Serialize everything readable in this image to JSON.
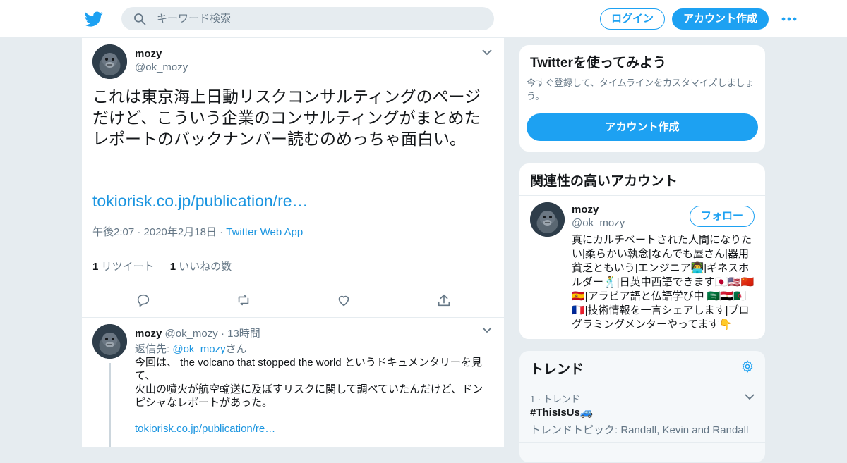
{
  "header": {
    "search_placeholder": "キーワード検索",
    "login_label": "ログイン",
    "signup_label": "アカウント作成"
  },
  "tweet": {
    "name": "mozy",
    "handle": "@ok_mozy",
    "text": "これは東京海上日動リスクコンサルティングのページだけど、こういう企業のコンサルティングがまとめたレポートのバックナンバー読むのめっちゃ面白い。",
    "link": "tokiorisk.co.jp/publication/re…",
    "timestamp": "午後2:07 · 2020年2月18日 ·",
    "via": "Twitter Web App",
    "retweet_count": "1",
    "retweet_label": "リツイート",
    "like_count": "1",
    "like_label": "いいねの数"
  },
  "reply": {
    "name": "mozy",
    "handle": "@ok_mozy",
    "time": "· 13時間",
    "reply_to_label": "返信先:",
    "reply_to_handle": "@ok_mozy",
    "reply_to_suffix": "さん",
    "text": "今回は、 the volcano that stopped the world というドキュメンタリーを見て、\n火山の噴火が航空輸送に及ぼすリスクに関して調べていたんだけど、ドンピシャなレポートがあった。",
    "link": "tokiorisk.co.jp/publication/re…"
  },
  "signup_card": {
    "title": "Twitterを使ってみよう",
    "desc": "今すぐ登録して、タイムラインをカスタマイズしましょう。",
    "button": "アカウント作成"
  },
  "related_card": {
    "title": "関連性の高いアカウント",
    "name": "mozy",
    "handle": "@ok_mozy",
    "follow_label": "フォロー",
    "bio": "真にカルチベートされた人間になりたい|柔らかい執念|なんでも屋さん|器用貧乏ともいう|エンジニア👨‍💻|ギネスホルダー🕺|日英中西語できます🇯🇵🇺🇸🇨🇳🇪🇸|アラビア語と仏語学び中 🇸🇦🇪🇬🇩🇿🇫🇷|技術情報を一言シェアします|プログラミングメンターやってます👇"
  },
  "trends": {
    "title": "トレンド",
    "items": [
      {
        "rank": "1 · トレンド",
        "tag": "#ThisIsUs🚙",
        "topic": "トレンドトピック: Randall, Kevin and Randall"
      }
    ]
  },
  "colors": {
    "accent": "#1da1f2",
    "link": "#1b95e0",
    "background": "#e6ecf0"
  },
  "icons": [
    "twitter-bird-icon",
    "search-icon",
    "more-icon",
    "chevron-down-icon",
    "reply-icon",
    "retweet-icon",
    "like-icon",
    "share-icon",
    "gear-icon"
  ]
}
